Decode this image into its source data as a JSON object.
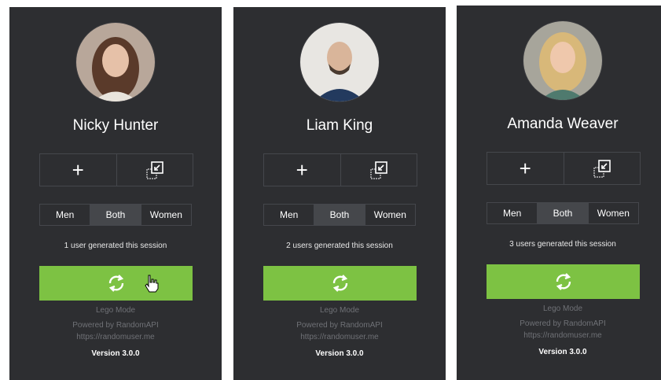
{
  "cards": [
    {
      "name": "Nicky Hunter",
      "add_icon": "plus-icon",
      "link_icon": "open-link-icon",
      "gender": {
        "men": "Men",
        "both": "Both",
        "women": "Women",
        "selected": "Both"
      },
      "session_text": "1 user generated this session",
      "generate_icon": "refresh-icon",
      "lego_mode": "Lego Mode",
      "powered_by": "Powered by RandomAPI",
      "url": "https://randomuser.me",
      "version": "Version 3.0.0"
    },
    {
      "name": "Liam King",
      "add_icon": "plus-icon",
      "link_icon": "open-link-icon",
      "gender": {
        "men": "Men",
        "both": "Both",
        "women": "Women",
        "selected": "Both"
      },
      "session_text": "2 users generated this session",
      "generate_icon": "refresh-icon",
      "lego_mode": "Lego Mode",
      "powered_by": "Powered by RandomAPI",
      "url": "https://randomuser.me",
      "version": "Version 3.0.0"
    },
    {
      "name": "Amanda Weaver",
      "add_icon": "plus-icon",
      "link_icon": "open-link-icon",
      "gender": {
        "men": "Men",
        "both": "Both",
        "women": "Women",
        "selected": "Both"
      },
      "session_text": "3 users generated this session",
      "generate_icon": "refresh-icon",
      "lego_mode": "Lego Mode",
      "powered_by": "Powered by RandomAPI",
      "url": "https://randomuser.me",
      "version": "Version 3.0.0"
    }
  ],
  "colors": {
    "card_background": "#2d2e31",
    "accent_green": "#7dc243",
    "segment_active": "#45474b",
    "muted_text": "#6f7176"
  }
}
